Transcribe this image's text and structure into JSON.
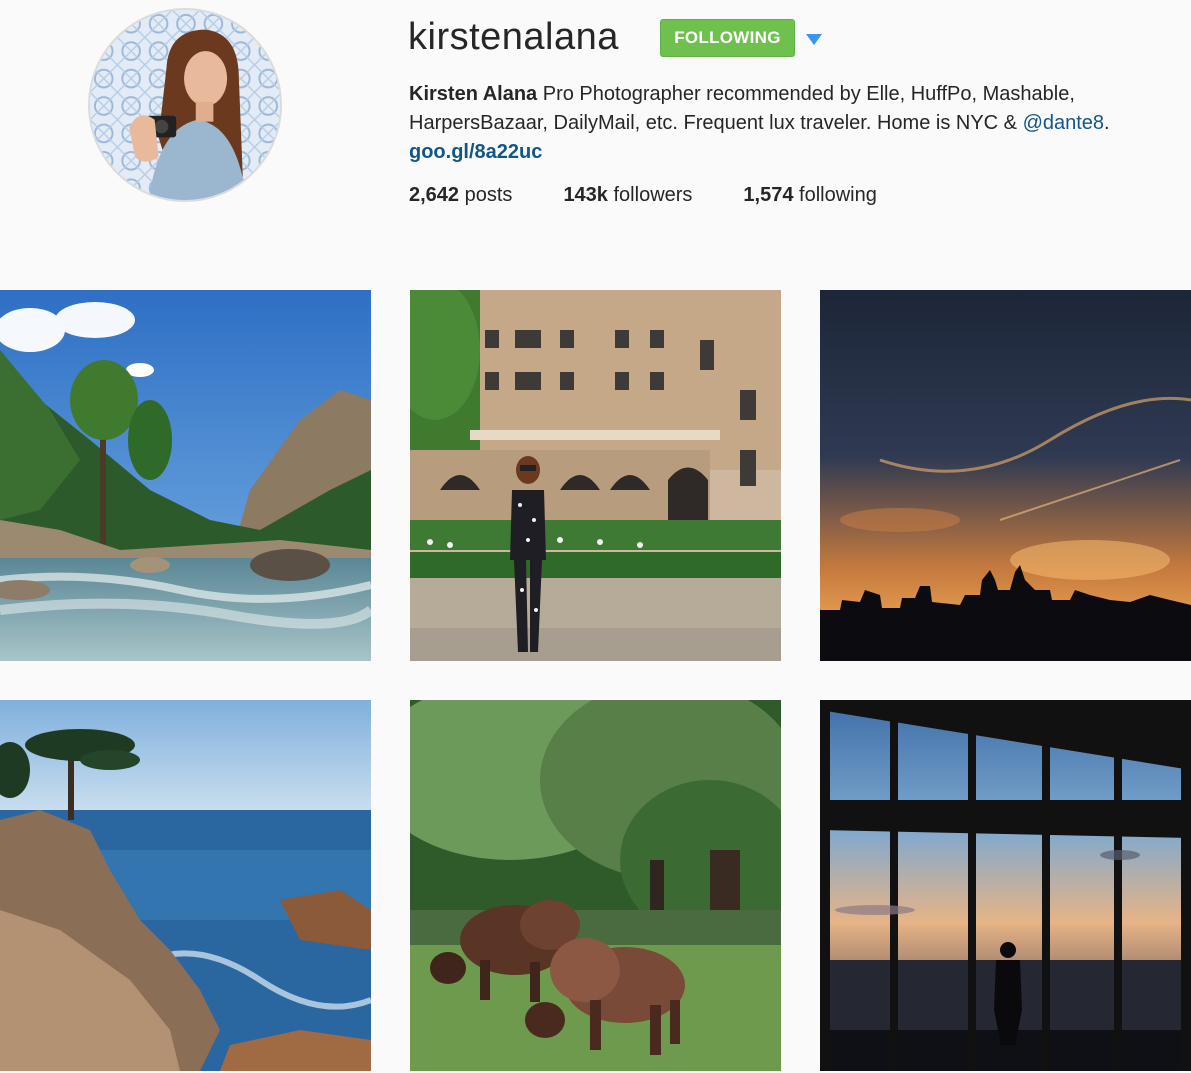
{
  "profile": {
    "username": "kirstenalana",
    "follow_label": "FOLLOWING",
    "full_name": "Kirsten Alana",
    "bio_text": " Pro Photographer recommended by Elle, HuffPo, Mashable, HarpersBazaar, DailyMail, etc. Frequent lux traveler. Home is NYC & ",
    "bio_mention": "@dante8",
    "bio_end": ".",
    "link": "goo.gl/8a22uc",
    "stats": {
      "posts_count": "2,642",
      "posts_label": "posts",
      "followers_count": "143k",
      "followers_label": "followers",
      "following_count": "1,574",
      "following_label": "following"
    },
    "icons": {
      "dropdown": "caret-down-icon"
    }
  },
  "colors": {
    "follow_green": "#70c050",
    "link_blue": "#125688",
    "dropdown_blue": "#3897f0"
  },
  "posts": [
    {
      "id": "mountain-river"
    },
    {
      "id": "museum-natural-history"
    },
    {
      "id": "city-sunset-skyline"
    },
    {
      "id": "coastal-cypress"
    },
    {
      "id": "bison-grazing"
    },
    {
      "id": "observation-window"
    }
  ]
}
